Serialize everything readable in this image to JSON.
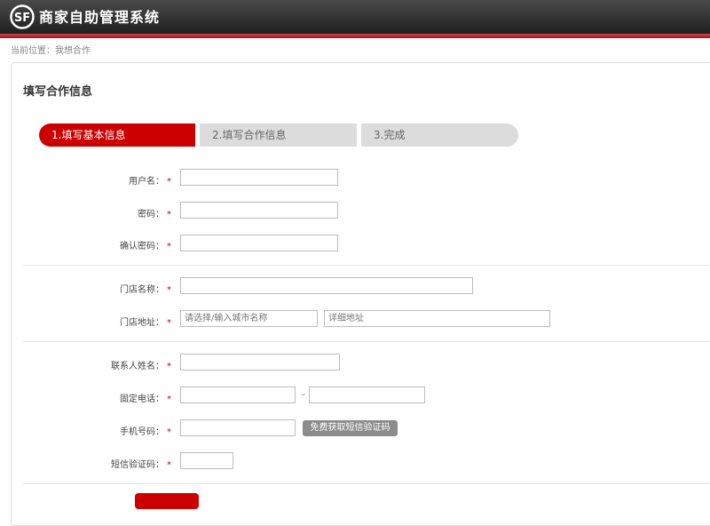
{
  "header": {
    "title": "商家自助管理系统",
    "logo_text": "SF"
  },
  "breadcrumb": "当前位置：我想合作",
  "panel": {
    "title": "填写合作信息"
  },
  "steps": [
    {
      "label": "1.填写基本信息",
      "active": true
    },
    {
      "label": "2.填写合作信息",
      "active": false
    },
    {
      "label": "3.完成",
      "active": false
    }
  ],
  "form": {
    "username_label": "用户名：",
    "password_label": "密码：",
    "confirm_password_label": "确认密码：",
    "store_name_label": "门店名称：",
    "store_address_label": "门店地址：",
    "city_placeholder": "请选择/输入城市名称",
    "detail_address_placeholder": "详细地址",
    "contact_name_label": "联系人姓名：",
    "landline_label": "固定电话：",
    "landline_separator": "-",
    "mobile_label": "手机号码：",
    "sms_button": "免费获取短信验证码",
    "sms_code_label": "短信验证码：",
    "required_mark": "*"
  },
  "colors": {
    "accent": "#cc0000",
    "header_dark": "#2b2b2b",
    "step_inactive": "#dcdcdc"
  }
}
